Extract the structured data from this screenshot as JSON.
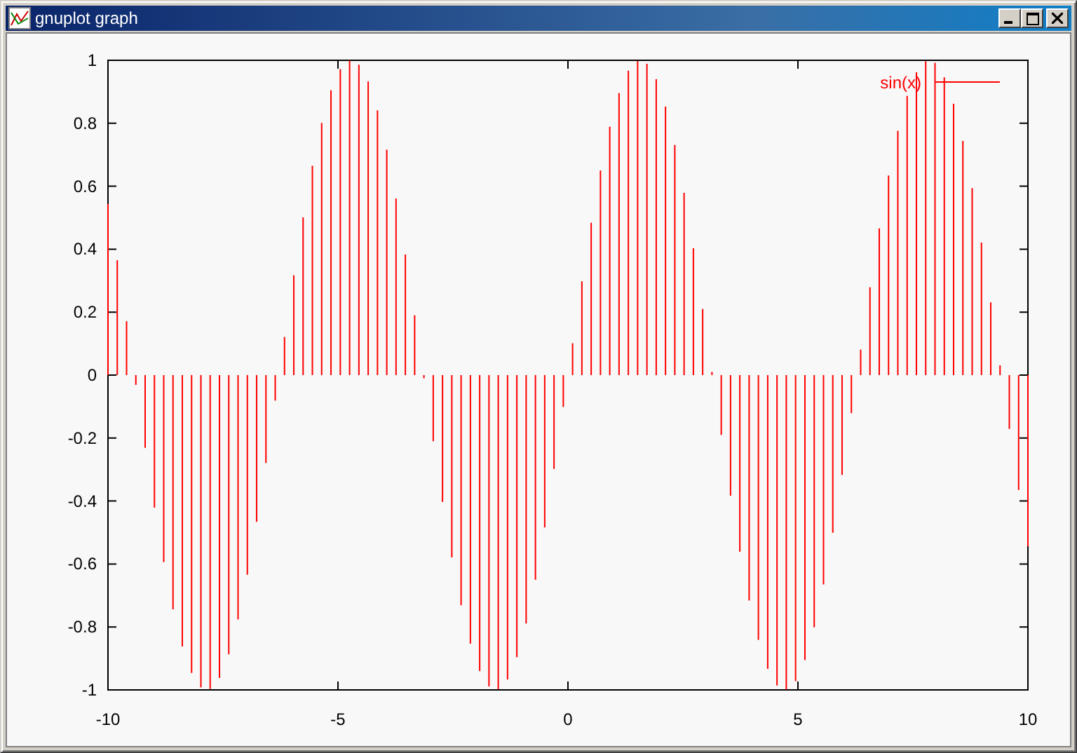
{
  "window": {
    "title": "gnuplot graph"
  },
  "chart_data": {
    "type": "bar",
    "xlim": [
      -10,
      10
    ],
    "ylim": [
      -1,
      1
    ],
    "xticks": [
      -10,
      -5,
      0,
      5,
      10
    ],
    "yticks": [
      -1,
      -0.8,
      -0.6,
      -0.4,
      -0.2,
      0,
      0.2,
      0.4,
      0.6,
      0.8,
      1
    ],
    "x": [
      -10,
      -9.798,
      -9.596,
      -9.394,
      -9.192,
      -8.99,
      -8.788,
      -8.586,
      -8.384,
      -8.182,
      -7.98,
      -7.778,
      -7.576,
      -7.374,
      -7.172,
      -6.97,
      -6.768,
      -6.566,
      -6.364,
      -6.162,
      -5.96,
      -5.758,
      -5.556,
      -5.354,
      -5.152,
      -4.949,
      -4.747,
      -4.545,
      -4.343,
      -4.141,
      -3.939,
      -3.737,
      -3.535,
      -3.333,
      -3.131,
      -2.929,
      -2.727,
      -2.525,
      -2.323,
      -2.121,
      -1.919,
      -1.717,
      -1.515,
      -1.313,
      -1.111,
      -0.909,
      -0.707,
      -0.505,
      -0.303,
      -0.101,
      0.101,
      0.303,
      0.505,
      0.707,
      0.909,
      1.111,
      1.313,
      1.515,
      1.717,
      1.919,
      2.121,
      2.323,
      2.525,
      2.727,
      2.929,
      3.131,
      3.333,
      3.535,
      3.737,
      3.939,
      4.141,
      4.343,
      4.545,
      4.747,
      4.949,
      5.152,
      5.354,
      5.556,
      5.758,
      5.96,
      6.162,
      6.364,
      6.566,
      6.768,
      6.97,
      7.172,
      7.374,
      7.576,
      7.778,
      7.98,
      8.182,
      8.384,
      8.586,
      8.788,
      8.99,
      9.192,
      9.394,
      9.596,
      9.798,
      10
    ],
    "series": [
      {
        "name": "sin(x)",
        "color": "#ff0000",
        "values": [
          0.544,
          0.365,
          0.171,
          -0.031,
          -0.231,
          -0.421,
          -0.594,
          -0.744,
          -0.862,
          -0.946,
          -0.992,
          -0.997,
          -0.962,
          -0.887,
          -0.776,
          -0.634,
          -0.466,
          -0.279,
          -0.081,
          0.121,
          0.317,
          0.501,
          0.665,
          0.801,
          0.905,
          0.972,
          0.999,
          0.986,
          0.933,
          0.841,
          0.716,
          0.561,
          0.383,
          0.19,
          -0.01,
          -0.21,
          -0.403,
          -0.579,
          -0.731,
          -0.853,
          -0.94,
          -0.989,
          -0.998,
          -0.967,
          -0.896,
          -0.789,
          -0.65,
          -0.484,
          -0.298,
          -0.101,
          0.101,
          0.298,
          0.484,
          0.65,
          0.789,
          0.896,
          0.967,
          0.998,
          0.989,
          0.94,
          0.853,
          0.731,
          0.579,
          0.403,
          0.21,
          0.01,
          -0.19,
          -0.383,
          -0.561,
          -0.716,
          -0.841,
          -0.933,
          -0.986,
          -0.999,
          -0.972,
          -0.905,
          -0.801,
          -0.665,
          -0.501,
          -0.317,
          -0.121,
          0.081,
          0.279,
          0.466,
          0.634,
          0.776,
          0.887,
          0.962,
          0.997,
          0.992,
          0.946,
          0.862,
          0.744,
          0.594,
          0.421,
          0.231,
          0.031,
          -0.171,
          -0.365,
          -0.544
        ]
      }
    ]
  }
}
